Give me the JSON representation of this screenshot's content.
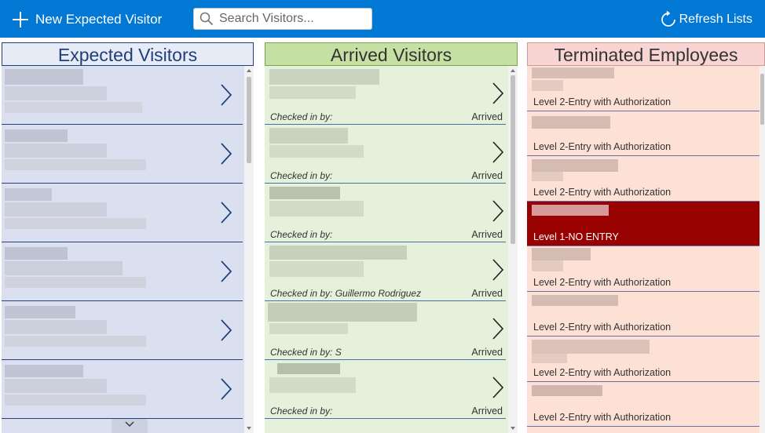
{
  "toolbar": {
    "new_visitor_label": "New Expected Visitor",
    "search_placeholder": "Search Visitors...",
    "refresh_label": "Refresh Lists",
    "icons": {
      "new": "plus-icon",
      "search": "search-icon",
      "refresh": "refresh-icon"
    }
  },
  "expected": {
    "title": "Expected Visitors",
    "rows": [
      {
        "name": "",
        "detail": ""
      },
      {
        "name": "",
        "detail": ""
      },
      {
        "name": "",
        "detail": ""
      },
      {
        "name": "",
        "detail": ""
      },
      {
        "name": "",
        "detail": ""
      },
      {
        "name": "",
        "detail": ""
      }
    ]
  },
  "arrived": {
    "title": "Arrived Visitors",
    "rows": [
      {
        "checked_label": "Checked in by:",
        "status": "Arrived"
      },
      {
        "checked_label": "Checked in by:",
        "status": "Arrived"
      },
      {
        "checked_label": "Checked in by:",
        "status": "Arrived"
      },
      {
        "checked_label": "Checked in by: Guillermo Rodriguez",
        "status": "Arrived"
      },
      {
        "checked_label": "Checked in by: S",
        "status": "Arrived"
      },
      {
        "checked_label": "Checked in by:",
        "status": "Arrived"
      }
    ]
  },
  "terminated": {
    "title": "Terminated Employees",
    "rows": [
      {
        "level": "Level 2-Entry with Authorization"
      },
      {
        "level": "Level 2-Entry with Authorization"
      },
      {
        "level": "Level 2-Entry with Authorization"
      },
      {
        "level": "Level 1-NO ENTRY"
      },
      {
        "level": "Level 2-Entry with Authorization"
      },
      {
        "level": "Level 2-Entry with Authorization"
      },
      {
        "level": "Level 2-Entry with Authorization"
      },
      {
        "level": "Level 2-Entry with Authorization"
      }
    ]
  },
  "colors": {
    "topbar": "#0078d4",
    "expected_bg": "#dae0ef",
    "arrived_bg": "#e5f1db",
    "terminated_bg": "#fde1d4",
    "no_entry": "#990000"
  }
}
